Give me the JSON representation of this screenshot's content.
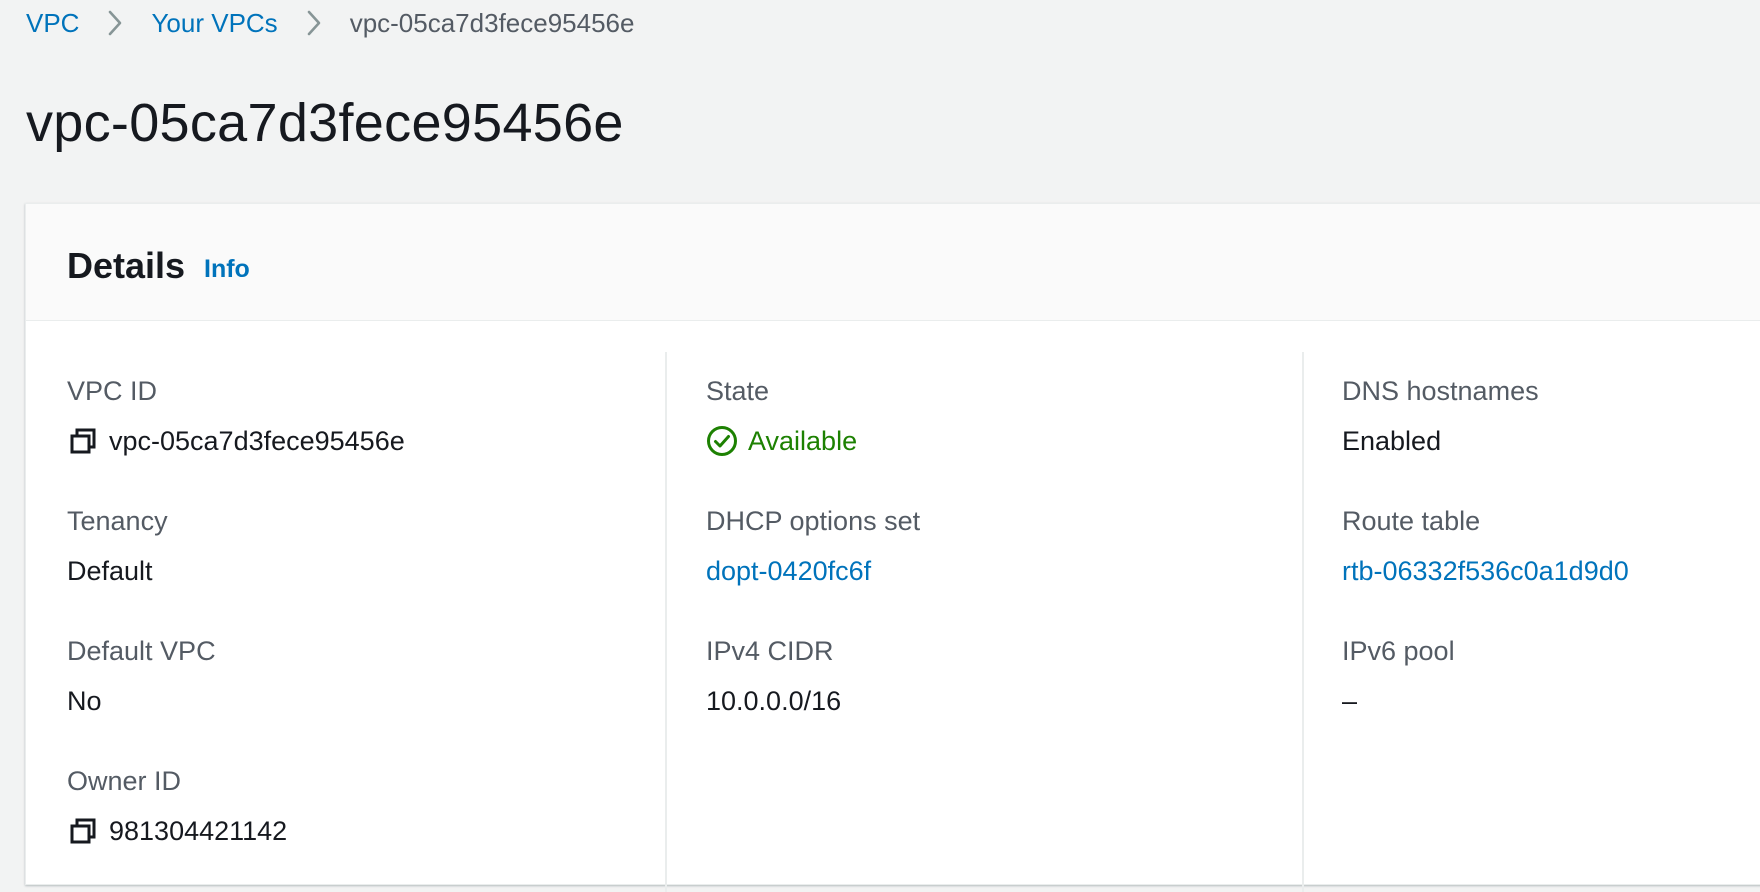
{
  "breadcrumb": {
    "items": [
      "VPC",
      "Your VPCs"
    ],
    "current": "vpc-05ca7d3fece95456e"
  },
  "page": {
    "title": "vpc-05ca7d3fece95456e"
  },
  "details": {
    "title": "Details",
    "info_label": "Info",
    "fields": {
      "vpc_id": {
        "label": "VPC ID",
        "value": "vpc-05ca7d3fece95456e"
      },
      "tenancy": {
        "label": "Tenancy",
        "value": "Default"
      },
      "default_vpc": {
        "label": "Default VPC",
        "value": "No"
      },
      "owner_id": {
        "label": "Owner ID",
        "value": "981304421142"
      },
      "state": {
        "label": "State",
        "value": "Available"
      },
      "dhcp_options_set": {
        "label": "DHCP options set",
        "value": "dopt-0420fc6f"
      },
      "ipv4_cidr": {
        "label": "IPv4 CIDR",
        "value": "10.0.0.0/16"
      },
      "dns_hostnames": {
        "label": "DNS hostnames",
        "value": "Enabled"
      },
      "route_table": {
        "label": "Route table",
        "value": "rtb-06332f536c0a1d9d0"
      },
      "ipv6_pool": {
        "label": "IPv6 pool",
        "value": "–"
      }
    }
  },
  "icons": {
    "separator": "chevron-right-icon",
    "copy": "copy-icon",
    "status": "check-circle-icon"
  },
  "colors": {
    "background": "#f2f3f3",
    "link": "#0073bb",
    "success": "#1d8102",
    "text": "#16191f",
    "label": "#545b64"
  }
}
